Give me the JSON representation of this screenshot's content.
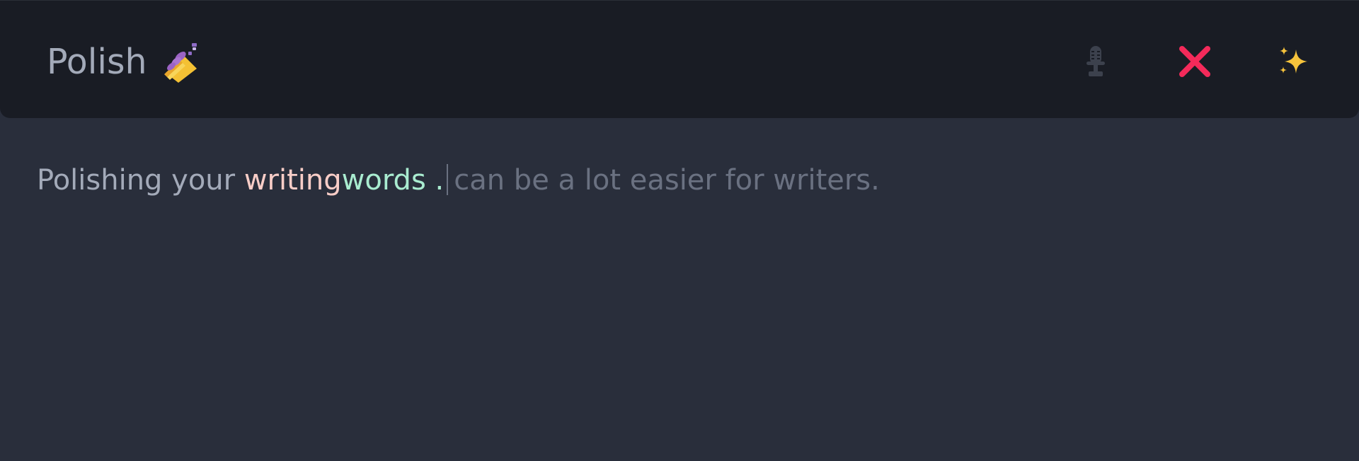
{
  "header": {
    "title": "Polish",
    "title_icon": "nail-polish-icon",
    "buttons": [
      {
        "name": "microphone",
        "icon": "microphone-icon",
        "color": "#3c414d"
      },
      {
        "name": "close",
        "icon": "close-icon",
        "color": "#f42a5a"
      },
      {
        "name": "sparkle",
        "icon": "sparkles-icon",
        "color": "#f6c33c"
      }
    ]
  },
  "editor": {
    "text_before": "Polishing your ",
    "removed_word": "writing",
    "added_word": "words",
    "after_added": " .",
    "suggestion": "can be a lot easier for writers."
  },
  "colors": {
    "background": "#292e3b",
    "header_background": "#191c24",
    "text": "#a3aab9",
    "removed": "#f8cdc7",
    "added": "#a9ecd0",
    "suggestion": "#6a7181"
  }
}
